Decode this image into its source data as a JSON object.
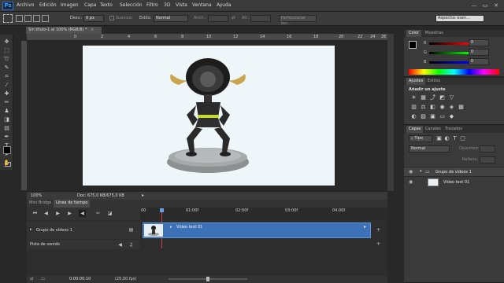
{
  "app": {
    "logo": "Ps",
    "window_controls": [
      "—",
      "▭",
      "✕"
    ]
  },
  "menu": [
    "Archivo",
    "Edición",
    "Imagen",
    "Capa",
    "Texto",
    "Selección",
    "Filtro",
    "3D",
    "Vista",
    "Ventana",
    "Ayuda"
  ],
  "options": {
    "desv_label": "Desv.:",
    "desv_value": "0 px",
    "suavizar": "Suavizar",
    "estilo_label": "Estilo:",
    "estilo_value": "Normal",
    "anch_label": "Anch.:",
    "alt_label": "Alt.:",
    "refine": "Perfeccionar bor...",
    "workspace": "Aspectos esen..."
  },
  "document": {
    "tab": "Sin título-1 al 100% (RGB/8) *",
    "zoom": "100%",
    "doc_info": "Doc: 675,0 KB/675,0 KB",
    "ruler_marks": [
      "0",
      "2",
      "4",
      "6",
      "8",
      "10",
      "12",
      "14",
      "16",
      "18",
      "20",
      "22",
      "24",
      "26"
    ]
  },
  "colors": {
    "accent": "#2d6ab0",
    "panel": "#3a3a3a",
    "bg": "#282828",
    "clip": "#3e72b8"
  },
  "color_panel": {
    "tabs": [
      "Color",
      "Muestras"
    ],
    "channels": [
      {
        "label": "R",
        "value": "0"
      },
      {
        "label": "G",
        "value": "0"
      },
      {
        "label": "B",
        "value": "0"
      }
    ]
  },
  "adjustments": {
    "tabs": [
      "Ajustes",
      "Estilos"
    ],
    "title": "Añadir un ajuste"
  },
  "layers_panel": {
    "tabs": [
      "Capas",
      "Canales",
      "Trazados"
    ],
    "kind": "Tipo",
    "blend": "Normal",
    "opacity_label": "Opacidad:",
    "fill_label": "Relleno:",
    "group": "Grupo de vídeos 1",
    "layer": "Vídeo test 01"
  },
  "timeline": {
    "tabs": [
      "Mini Bridge",
      "Línea de tiempo"
    ],
    "marks": [
      "00",
      "01:00f",
      "02:00f",
      "03:00f",
      "04:00f"
    ],
    "tracks": [
      {
        "label": "Grupo de vídeos 1"
      },
      {
        "label": "Pista de sonido"
      }
    ],
    "clip_label": "Vídeo test 01",
    "timecode": "0:00:00:10",
    "fps": "(25,00 fps)"
  }
}
